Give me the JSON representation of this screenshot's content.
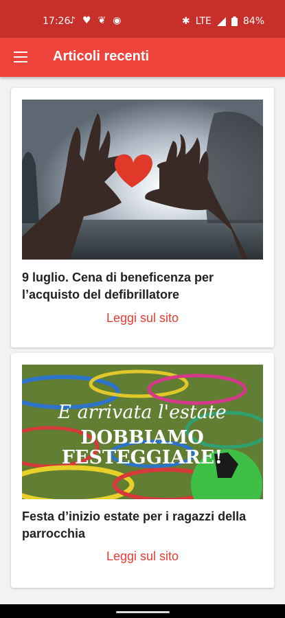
{
  "status_bar": {
    "time": "17:26",
    "network": "LTE",
    "battery": "84%"
  },
  "app_bar": {
    "title": "Articoli recenti",
    "menu_icon": "hamburger-menu-icon"
  },
  "articles": [
    {
      "title": "9 luglio. Cena di beneficenza per l’acquisto del defibrillatore",
      "link_label": "Leggi sul sito"
    },
    {
      "title": "Festa d’inizio estate per i ragazzi della parrocchia",
      "link_label": "Leggi sul sito",
      "image_text": {
        "line1": "E arrivata l'estate",
        "line2": "DOBBIAMO",
        "line3": "FESTEGGIARE!"
      }
    }
  ],
  "colors": {
    "status_bar": "#c62f2a",
    "app_bar": "#ef443b",
    "link": "#e53c32"
  }
}
